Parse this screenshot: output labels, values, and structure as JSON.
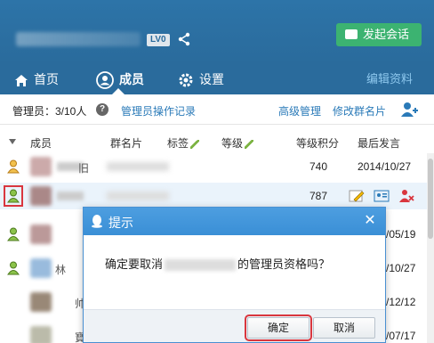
{
  "header": {
    "level_badge": "LV0",
    "start_chat_label": "发起会话"
  },
  "nav": {
    "tabs": [
      {
        "label": "首页"
      },
      {
        "label": "成员"
      },
      {
        "label": "设置"
      }
    ],
    "edit_profile": "编辑资料"
  },
  "toolbar": {
    "admin_count": "管理员：3/10人",
    "help": "?",
    "admin_log": "管理员操作记录",
    "advanced_mgmt": "高级管理",
    "edit_card": "修改群名片"
  },
  "table": {
    "headers": {
      "member": "成员",
      "card": "群名片",
      "tag": "标签",
      "level": "等级",
      "points": "等级积分",
      "last": "最后发言"
    },
    "rows": [
      {
        "name_tail": "旧",
        "points": "740",
        "last": "2014/10/27"
      },
      {
        "name_tail": "",
        "points": "787",
        "last": ""
      },
      {
        "name_tail": "",
        "points": "",
        "last": "/05/19"
      },
      {
        "name_tail": "林",
        "points": "",
        "last": "/10/27"
      },
      {
        "name_tail": "帅",
        "points": "",
        "last": "/12/12"
      },
      {
        "name_tail": "寶",
        "points": "",
        "last": "/07/17"
      }
    ]
  },
  "dialog": {
    "title": "提示",
    "close": "✕",
    "message_before": "确定要取消",
    "message_after": "的管理员资格吗？",
    "ok_label": "确定",
    "cancel_label": "取消"
  },
  "colors": {
    "header_bg": "#2a6b9c",
    "accent_link": "#2a7ab8",
    "start_chat_green": "#3cb371",
    "highlight_red": "#d9363e"
  }
}
